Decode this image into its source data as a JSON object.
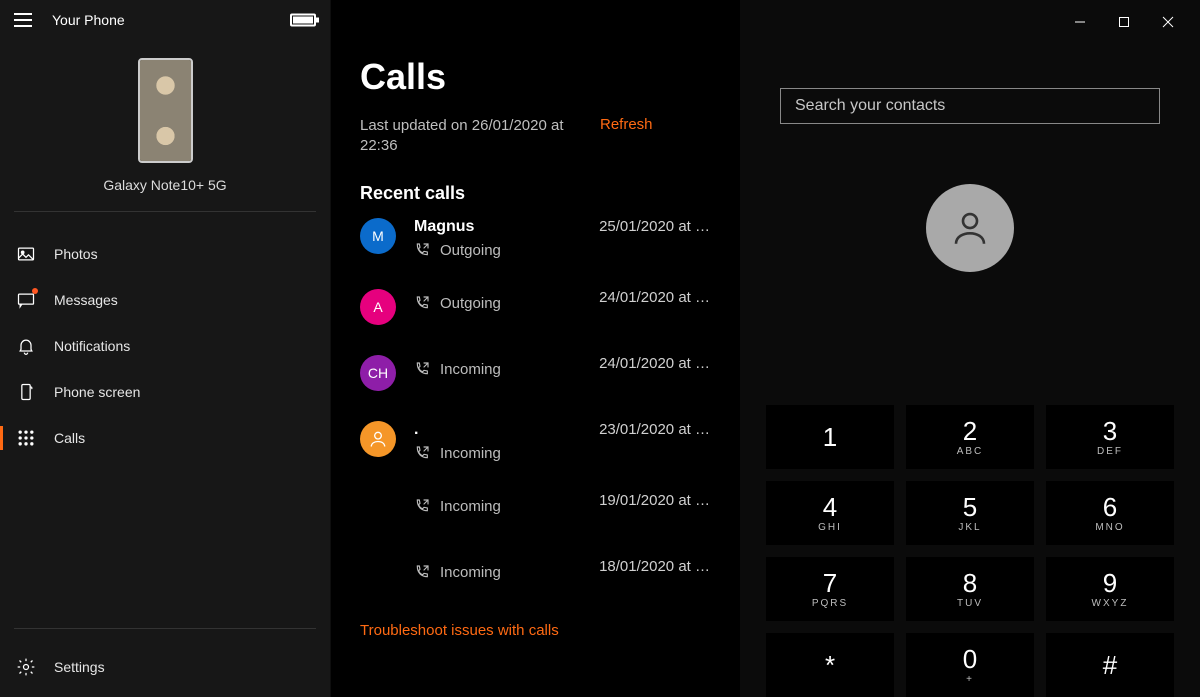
{
  "header": {
    "app_title": "Your Phone"
  },
  "device": {
    "name": "Galaxy Note10+ 5G"
  },
  "sidebar": {
    "items": [
      {
        "label": "Photos",
        "icon": "photos-icon",
        "badge": false
      },
      {
        "label": "Messages",
        "icon": "messages-icon",
        "badge": true
      },
      {
        "label": "Notifications",
        "icon": "notifications-icon",
        "badge": false
      },
      {
        "label": "Phone screen",
        "icon": "phone-screen-icon",
        "badge": false
      },
      {
        "label": "Calls",
        "icon": "calls-icon",
        "badge": false
      }
    ],
    "settings_label": "Settings"
  },
  "calls": {
    "title": "Calls",
    "last_updated": "Last updated on 26/01/2020 at 22:36",
    "refresh_label": "Refresh",
    "recent_header": "Recent calls",
    "troubleshoot_label": "Troubleshoot issues with calls",
    "items": [
      {
        "name": "Magnus",
        "initial": "M",
        "color": "#0b6bcb",
        "type": "person-initial",
        "direction": "Outgoing",
        "date": "25/01/2020 at …"
      },
      {
        "name": "",
        "initial": "A",
        "color": "#e6007e",
        "type": "person-initial",
        "direction": "Outgoing",
        "date": "24/01/2020 at …"
      },
      {
        "name": "",
        "initial": "CH",
        "color": "#8e1ea8",
        "type": "person-initial",
        "direction": "Incoming",
        "date": "24/01/2020 at …"
      },
      {
        "name": ".",
        "initial": "",
        "color": "#f59628",
        "type": "person-icon",
        "direction": "Incoming",
        "date": "23/01/2020 at …"
      },
      {
        "name": "",
        "initial": "",
        "color": "",
        "type": "none",
        "direction": "Incoming",
        "date": "19/01/2020 at …"
      },
      {
        "name": "",
        "initial": "",
        "color": "",
        "type": "none",
        "direction": "Incoming",
        "date": "18/01/2020 at …"
      }
    ]
  },
  "dialer": {
    "search_placeholder": "Search your contacts",
    "keys": [
      {
        "digit": "1",
        "letters": ""
      },
      {
        "digit": "2",
        "letters": "ABC"
      },
      {
        "digit": "3",
        "letters": "DEF"
      },
      {
        "digit": "4",
        "letters": "GHI"
      },
      {
        "digit": "5",
        "letters": "JKL"
      },
      {
        "digit": "6",
        "letters": "MNO"
      },
      {
        "digit": "7",
        "letters": "PQRS"
      },
      {
        "digit": "8",
        "letters": "TUV"
      },
      {
        "digit": "9",
        "letters": "WXYZ"
      },
      {
        "digit": "*",
        "letters": ""
      },
      {
        "digit": "0",
        "letters": "+"
      },
      {
        "digit": "#",
        "letters": ""
      }
    ]
  },
  "icons": {
    "hamburger": "menu-icon",
    "battery": "battery-full-icon",
    "gear": "gear-icon",
    "minimize": "window-minimize-icon",
    "maximize": "window-maximize-icon",
    "close": "window-close-icon",
    "contact": "contact-avatar-icon"
  }
}
